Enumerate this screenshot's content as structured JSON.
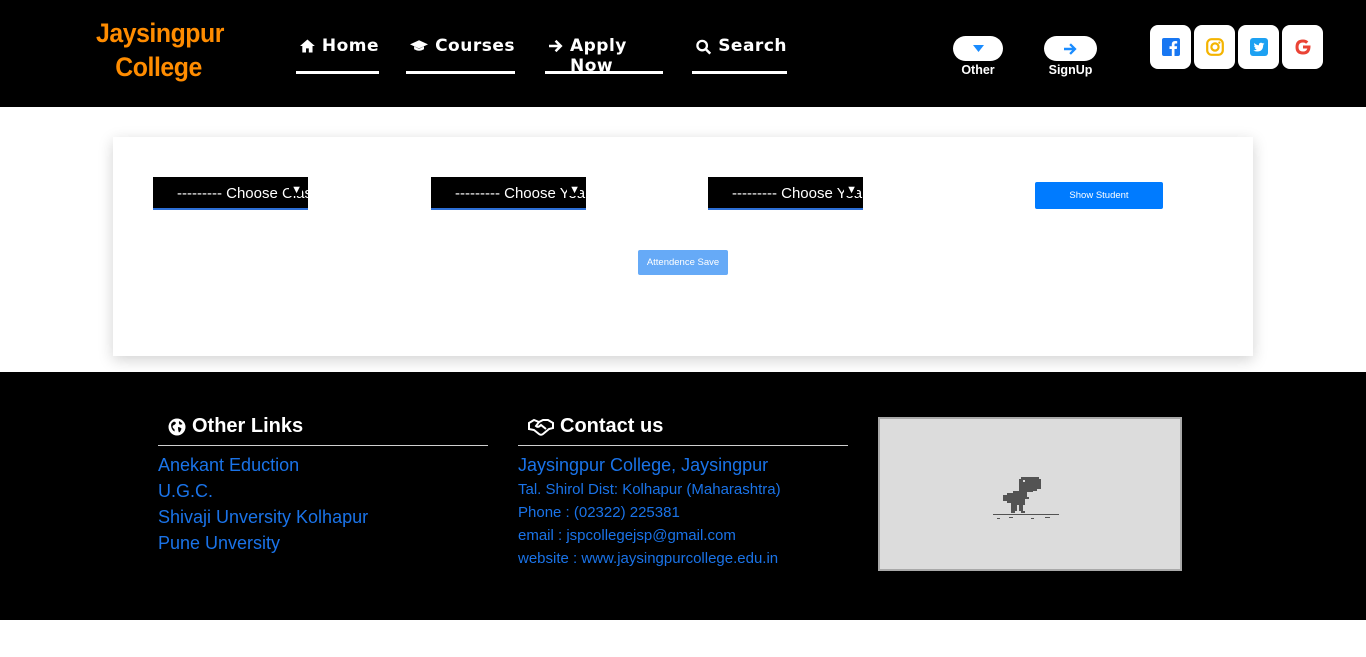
{
  "brand": {
    "line1": "Jaysingpur",
    "line2": "College",
    "color": "#ff8c00"
  },
  "nav": {
    "home": "Home",
    "courses": "Courses",
    "apply": "Apply Now",
    "search": "Search"
  },
  "user_menu": {
    "other": "Other",
    "signup": "SignUp"
  },
  "social": [
    {
      "icon": "facebook-icon",
      "color": "#1877f2"
    },
    {
      "icon": "instagram-icon",
      "color": "#f4b400"
    },
    {
      "icon": "twitter-icon",
      "color": "#1da1f2"
    },
    {
      "icon": "google-icon",
      "color": "#ea4335"
    }
  ],
  "filters": {
    "select1": "--------- Choose Class ---------",
    "select2": "--------- Choose Year ---------",
    "select3": "--------- Choose Year ---------",
    "show_button": "Show Student",
    "save_button": "Attendence Save"
  },
  "footer": {
    "links_title": "Other Links",
    "links": [
      "Anekant Eduction",
      "U.G.C.",
      "Shivaji Unversity Kolhapur",
      "Pune Unversity"
    ],
    "contact_title": "Contact us",
    "contact_name": "Jaysingpur College, Jaysingpur",
    "contact_address": "Tal. Shirol Dist: Kolhapur (Maharashtra)",
    "contact_phone": "Phone : (02322) 225381",
    "contact_email": "email : jspcollegejsp@gmail.com",
    "contact_website": "website : www.jaysingpurcollege.edu.in"
  },
  "colors": {
    "header_bg": "#000000",
    "link": "#1a73e8",
    "primary_button": "#007bff"
  }
}
